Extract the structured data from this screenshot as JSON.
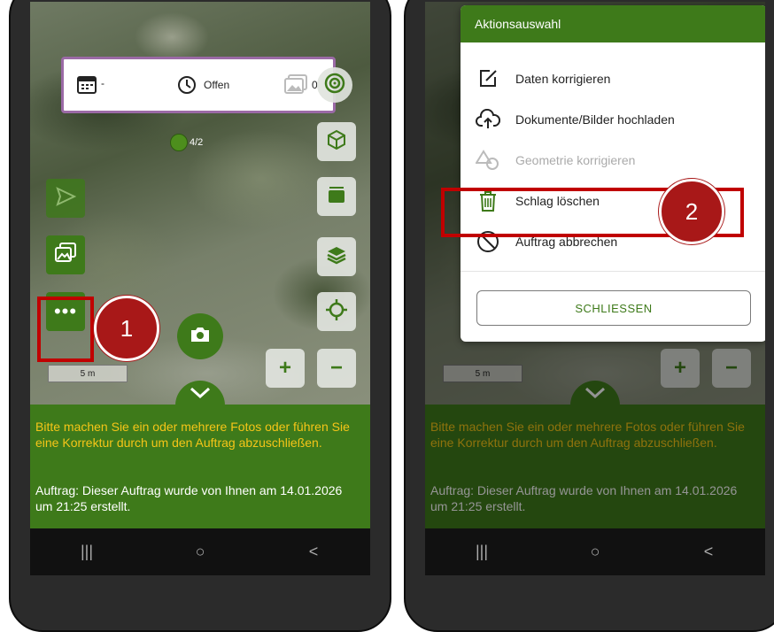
{
  "left_screen": {
    "infobox": {
      "date_value": "-",
      "status_label": "Offen",
      "photo_count": "0"
    },
    "counter": "4/2",
    "scale": "5 m",
    "step_badge": "1"
  },
  "right_screen": {
    "dialog": {
      "title": "Aktionsauswahl",
      "items": [
        {
          "label": "Daten korrigieren",
          "icon": "edit-icon",
          "enabled": true
        },
        {
          "label": "Dokumente/Bilder hochladen",
          "icon": "cloud-upload-icon",
          "enabled": true
        },
        {
          "label": "Geometrie korrigieren",
          "icon": "geometry-shapes-icon",
          "enabled": false
        },
        {
          "label": "Schlag löschen",
          "icon": "trash-icon",
          "enabled": true
        },
        {
          "label": "Auftrag abbrechen",
          "icon": "cancel-circle-icon",
          "enabled": true
        }
      ],
      "close_label": "SCHLIESSEN"
    },
    "scale": "5 m",
    "step_badge": "2"
  },
  "bottom_panel": {
    "hint": "Bitte machen Sie ein oder mehrere Fotos oder führen Sie eine Korrektur durch um den Auftrag abzuschließen.",
    "info": "Auftrag: Dieser Auftrag wurde von Ihnen am 14.01.2026 um 21:25 erstellt."
  },
  "navbar": {
    "recent": "|||",
    "home": "○",
    "back": "<"
  },
  "map_controls": {
    "zoom_in": "+",
    "zoom_out": "−"
  },
  "colors": {
    "brand_green": "#3e7a1a",
    "hint_yellow": "#f5c518",
    "highlight_red": "#c00000",
    "badge_red": "#a81818"
  }
}
